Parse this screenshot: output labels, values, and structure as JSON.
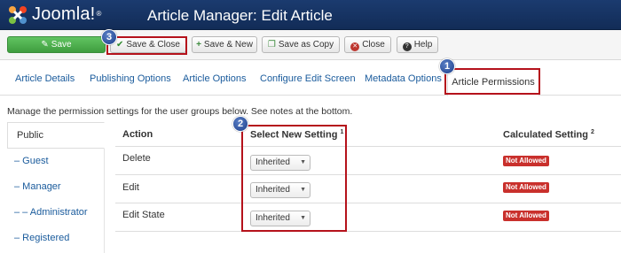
{
  "header": {
    "logo_text": "Joomla!",
    "logo_mark": "®",
    "title": "Article Manager: Edit Article"
  },
  "toolbar": {
    "save_label": "Save",
    "save_close_label": "Save & Close",
    "save_new_label": "Save & New",
    "save_copy_label": "Save as Copy",
    "close_label": "Close",
    "help_label": "Help"
  },
  "tabs": [
    {
      "label": "Article Details"
    },
    {
      "label": "Publishing Options"
    },
    {
      "label": "Article Options"
    },
    {
      "label": "Configure Edit Screen"
    },
    {
      "label": "Metadata Options"
    },
    {
      "label": "Article Permissions"
    }
  ],
  "intro_text": "Manage the permission settings for the user groups below. See notes at the bottom.",
  "groups": [
    {
      "label": "Public"
    },
    {
      "label": "– Guest"
    },
    {
      "label": "– Manager"
    },
    {
      "label": "– – Administrator"
    },
    {
      "label": "– Registered"
    }
  ],
  "table": {
    "headers": {
      "action": "Action",
      "select": "Select New Setting",
      "select_note": "1",
      "calculated": "Calculated Setting",
      "calculated_note": "2"
    },
    "rows": [
      {
        "action": "Delete",
        "setting": "Inherited",
        "calculated": "Not Allowed"
      },
      {
        "action": "Edit",
        "setting": "Inherited",
        "calculated": "Not Allowed"
      },
      {
        "action": "Edit State",
        "setting": "Inherited",
        "calculated": "Not Allowed"
      }
    ]
  },
  "callouts": [
    "1",
    "2",
    "3"
  ],
  "colors": {
    "header_bg": "#1b3b6f",
    "save_green": "#51a351",
    "link_blue": "#1a5b9c",
    "not_allowed_red": "#c9302c",
    "callout_red": "#b5121b",
    "callout_blue": "#2c5fb0"
  },
  "icons": {
    "logo": "joomla-logo",
    "save": "save-icon",
    "save_close": "checkmark-icon",
    "save_new": "plus-icon",
    "save_copy": "copy-icon",
    "close": "close-icon",
    "help": "help-icon",
    "select_arrow": "chevron-down-icon"
  }
}
